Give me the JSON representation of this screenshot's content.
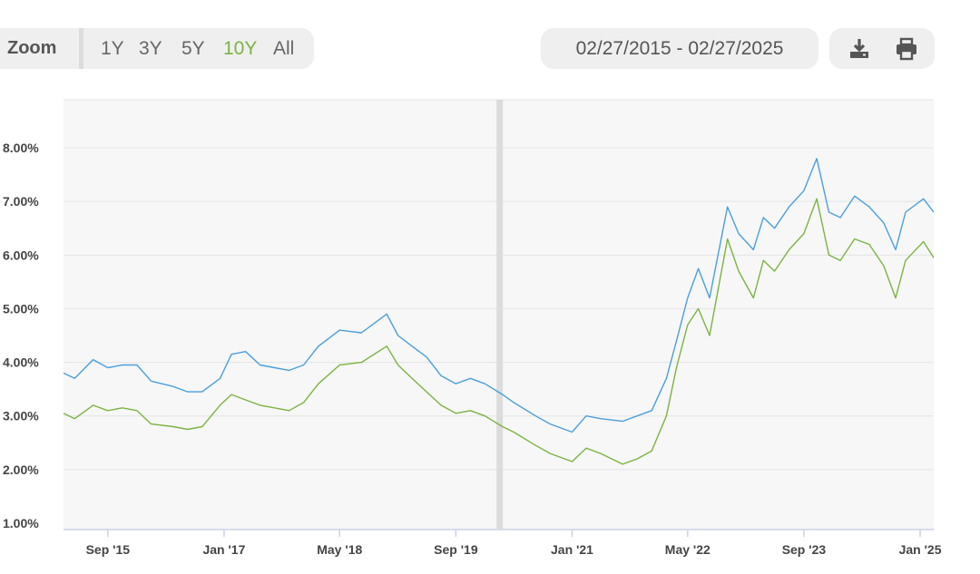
{
  "toolbar": {
    "zoom_label": "Zoom",
    "ranges": [
      "1Y",
      "3Y",
      "5Y",
      "10Y",
      "All"
    ],
    "active_range": "10Y",
    "date_range": "02/27/2015 - 02/27/2025",
    "download_icon": "download-icon",
    "print_icon": "print-icon"
  },
  "colors": {
    "series_blue": "#4a9fdc",
    "series_green": "#7cb342",
    "active": "#7cb342"
  },
  "chart_data": {
    "type": "line",
    "x_start": "2015-02-27",
    "x_end": "2025-02-27",
    "ylim": [
      0.75,
      9.0
    ],
    "yticks": [
      "1.00%",
      "2.00%",
      "3.00%",
      "4.00%",
      "5.00%",
      "6.00%",
      "7.00%",
      "8.00%"
    ],
    "xticks": [
      "Sep '15",
      "Jan '17",
      "May '18",
      "Sep '19",
      "Jan '21",
      "May '22",
      "Sep '23",
      "Jan '25"
    ],
    "grid": true,
    "highlight_band": "2020-03",
    "series": [
      {
        "color": "#4a9fdc",
        "points": [
          [
            "2015-02-27",
            3.8
          ],
          [
            "2015-04-15",
            3.7
          ],
          [
            "2015-07-01",
            4.05
          ],
          [
            "2015-09-01",
            3.9
          ],
          [
            "2015-11-01",
            3.95
          ],
          [
            "2016-01-01",
            3.95
          ],
          [
            "2016-03-01",
            3.65
          ],
          [
            "2016-06-01",
            3.55
          ],
          [
            "2016-08-01",
            3.45
          ],
          [
            "2016-10-01",
            3.45
          ],
          [
            "2016-12-15",
            3.7
          ],
          [
            "2017-02-01",
            4.15
          ],
          [
            "2017-04-01",
            4.2
          ],
          [
            "2017-06-01",
            3.95
          ],
          [
            "2017-08-01",
            3.9
          ],
          [
            "2017-10-01",
            3.85
          ],
          [
            "2017-12-01",
            3.95
          ],
          [
            "2018-02-01",
            4.3
          ],
          [
            "2018-05-01",
            4.6
          ],
          [
            "2018-08-01",
            4.55
          ],
          [
            "2018-11-15",
            4.9
          ],
          [
            "2019-01-01",
            4.5
          ],
          [
            "2019-03-01",
            4.3
          ],
          [
            "2019-05-01",
            4.1
          ],
          [
            "2019-07-01",
            3.75
          ],
          [
            "2019-09-01",
            3.6
          ],
          [
            "2019-11-01",
            3.7
          ],
          [
            "2020-01-01",
            3.6
          ],
          [
            "2020-03-15",
            3.4
          ],
          [
            "2020-05-01",
            3.25
          ],
          [
            "2020-08-01",
            3.0
          ],
          [
            "2020-10-01",
            2.85
          ],
          [
            "2021-01-01",
            2.7
          ],
          [
            "2021-03-01",
            3.0
          ],
          [
            "2021-05-01",
            2.95
          ],
          [
            "2021-08-01",
            2.9
          ],
          [
            "2021-10-01",
            3.0
          ],
          [
            "2021-12-01",
            3.1
          ],
          [
            "2022-02-01",
            3.7
          ],
          [
            "2022-03-15",
            4.4
          ],
          [
            "2022-05-01",
            5.2
          ],
          [
            "2022-06-15",
            5.75
          ],
          [
            "2022-08-01",
            5.2
          ],
          [
            "2022-10-15",
            6.9
          ],
          [
            "2022-12-01",
            6.4
          ],
          [
            "2023-02-01",
            6.1
          ],
          [
            "2023-03-15",
            6.7
          ],
          [
            "2023-05-01",
            6.5
          ],
          [
            "2023-07-01",
            6.9
          ],
          [
            "2023-09-01",
            7.2
          ],
          [
            "2023-10-25",
            7.8
          ],
          [
            "2023-12-15",
            6.8
          ],
          [
            "2024-02-01",
            6.7
          ],
          [
            "2024-04-01",
            7.1
          ],
          [
            "2024-06-01",
            6.9
          ],
          [
            "2024-08-01",
            6.6
          ],
          [
            "2024-09-20",
            6.1
          ],
          [
            "2024-11-01",
            6.8
          ],
          [
            "2025-01-15",
            7.05
          ],
          [
            "2025-02-27",
            6.8
          ]
        ]
      },
      {
        "color": "#7cb342",
        "points": [
          [
            "2015-02-27",
            3.05
          ],
          [
            "2015-04-15",
            2.95
          ],
          [
            "2015-07-01",
            3.2
          ],
          [
            "2015-09-01",
            3.1
          ],
          [
            "2015-11-01",
            3.15
          ],
          [
            "2016-01-01",
            3.1
          ],
          [
            "2016-03-01",
            2.85
          ],
          [
            "2016-06-01",
            2.8
          ],
          [
            "2016-08-01",
            2.75
          ],
          [
            "2016-10-01",
            2.8
          ],
          [
            "2016-12-15",
            3.2
          ],
          [
            "2017-02-01",
            3.4
          ],
          [
            "2017-04-01",
            3.3
          ],
          [
            "2017-06-01",
            3.2
          ],
          [
            "2017-08-01",
            3.15
          ],
          [
            "2017-10-01",
            3.1
          ],
          [
            "2017-12-01",
            3.25
          ],
          [
            "2018-02-01",
            3.6
          ],
          [
            "2018-05-01",
            3.95
          ],
          [
            "2018-08-01",
            4.0
          ],
          [
            "2018-11-15",
            4.3
          ],
          [
            "2019-01-01",
            3.95
          ],
          [
            "2019-03-01",
            3.7
          ],
          [
            "2019-05-01",
            3.45
          ],
          [
            "2019-07-01",
            3.2
          ],
          [
            "2019-09-01",
            3.05
          ],
          [
            "2019-11-01",
            3.1
          ],
          [
            "2020-01-01",
            3.0
          ],
          [
            "2020-03-15",
            2.8
          ],
          [
            "2020-05-01",
            2.7
          ],
          [
            "2020-08-01",
            2.45
          ],
          [
            "2020-10-01",
            2.3
          ],
          [
            "2021-01-01",
            2.15
          ],
          [
            "2021-03-01",
            2.4
          ],
          [
            "2021-05-01",
            2.3
          ],
          [
            "2021-08-01",
            2.1
          ],
          [
            "2021-10-01",
            2.2
          ],
          [
            "2021-12-01",
            2.35
          ],
          [
            "2022-02-01",
            3.0
          ],
          [
            "2022-03-15",
            3.9
          ],
          [
            "2022-05-01",
            4.7
          ],
          [
            "2022-06-15",
            5.0
          ],
          [
            "2022-08-01",
            4.5
          ],
          [
            "2022-10-15",
            6.3
          ],
          [
            "2022-12-01",
            5.7
          ],
          [
            "2023-02-01",
            5.2
          ],
          [
            "2023-03-15",
            5.9
          ],
          [
            "2023-05-01",
            5.7
          ],
          [
            "2023-07-01",
            6.1
          ],
          [
            "2023-09-01",
            6.4
          ],
          [
            "2023-10-25",
            7.05
          ],
          [
            "2023-12-15",
            6.0
          ],
          [
            "2024-02-01",
            5.9
          ],
          [
            "2024-04-01",
            6.3
          ],
          [
            "2024-06-01",
            6.2
          ],
          [
            "2024-08-01",
            5.8
          ],
          [
            "2024-09-20",
            5.2
          ],
          [
            "2024-11-01",
            5.9
          ],
          [
            "2025-01-15",
            6.25
          ],
          [
            "2025-02-27",
            5.95
          ]
        ]
      }
    ]
  }
}
